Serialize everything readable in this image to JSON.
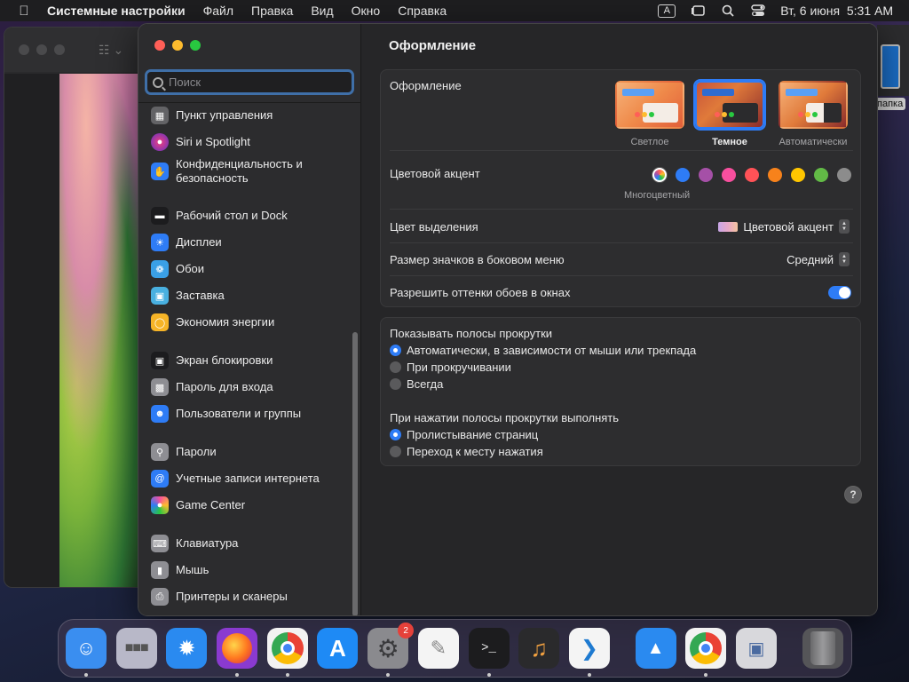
{
  "menubar": {
    "app_name": "Системные настройки",
    "items": [
      "Файл",
      "Правка",
      "Вид",
      "Окно",
      "Справка"
    ],
    "input_badge": "A",
    "datetime": "Вт, 6 июня  5:31 AM"
  },
  "background_window": {
    "edge_label": "папка"
  },
  "window": {
    "search_placeholder": "Поиск",
    "sidebar": [
      {
        "label": "Пункт управления",
        "icon": "control-center-icon",
        "color": "#636366"
      },
      {
        "label": "Siri и Spotlight",
        "icon": "siri-icon",
        "color": "#8e4ad6"
      },
      {
        "label": "Конфиденциальность и безопасность",
        "icon": "hand-icon",
        "color": "#2e7cf6"
      },
      {
        "label": "Рабочий стол и Dock",
        "icon": "dock-icon",
        "color": "#1c1c1e"
      },
      {
        "label": "Дисплеи",
        "icon": "sun-icon",
        "color": "#2e7cf6"
      },
      {
        "label": "Обои",
        "icon": "flower-icon",
        "color": "#3aa0e6"
      },
      {
        "label": "Заставка",
        "icon": "screensaver-icon",
        "color": "#49b0e0"
      },
      {
        "label": "Экономия энергии",
        "icon": "bulb-icon",
        "color": "#f6b427"
      },
      {
        "label": "Экран блокировки",
        "icon": "lock-screen-icon",
        "color": "#1c1c1e"
      },
      {
        "label": "Пароль для входа",
        "icon": "lock-icon",
        "color": "#8e8e93"
      },
      {
        "label": "Пользователи и группы",
        "icon": "users-icon",
        "color": "#2e7cf6"
      },
      {
        "label": "Пароли",
        "icon": "key-icon",
        "color": "#8e8e93"
      },
      {
        "label": "Учетные записи интернета",
        "icon": "at-icon",
        "color": "#2e7cf6"
      },
      {
        "label": "Game Center",
        "icon": "game-center-icon",
        "color": "#f2f2f2"
      },
      {
        "label": "Клавиатура",
        "icon": "keyboard-icon",
        "color": "#8e8e93"
      },
      {
        "label": "Мышь",
        "icon": "mouse-icon",
        "color": "#8e8e93"
      },
      {
        "label": "Принтеры и сканеры",
        "icon": "printer-icon",
        "color": "#8e8e93"
      }
    ],
    "content": {
      "title": "Оформление",
      "appearance_label": "Оформление",
      "themes": [
        {
          "label": "Светлое",
          "selected": false
        },
        {
          "label": "Темное",
          "selected": true
        },
        {
          "label": "Автоматически",
          "selected": false
        }
      ],
      "accent_label": "Цветовой акцент",
      "accent_caption": "Многоцветный",
      "accent_colors": [
        "multicolor",
        "#2e7cf6",
        "#a550a7",
        "#f74f9e",
        "#ff5257",
        "#f7821b",
        "#ffc600",
        "#62ba46",
        "#8c8c8c"
      ],
      "highlight_label": "Цвет выделения",
      "highlight_value": "Цветовой акцент",
      "sidebar_icon_size_label": "Размер значков в боковом меню",
      "sidebar_icon_size_value": "Средний",
      "wallpaper_tinting_label": "Разрешить оттенки обоев в окнах",
      "wallpaper_tinting_on": true,
      "scrollbars_label": "Показывать полосы прокрутки",
      "scrollbar_options": [
        {
          "label": "Автоматически, в зависимости от мыши или трекпада",
          "selected": true
        },
        {
          "label": "При прокручивании",
          "selected": false
        },
        {
          "label": "Всегда",
          "selected": false
        }
      ],
      "click_label": "При нажатии полосы прокрутки выполнять",
      "click_options": [
        {
          "label": "Пролистывание страниц",
          "selected": true
        },
        {
          "label": "Переход к месту нажатия",
          "selected": false
        }
      ],
      "help": "?"
    }
  },
  "dock": {
    "apps": [
      {
        "name": "finder-icon",
        "color": "#3a8ef0",
        "running": true
      },
      {
        "name": "launchpad-icon",
        "color": "#b8b8c8",
        "running": false
      },
      {
        "name": "safari-icon",
        "color": "#2a8af0",
        "running": false
      },
      {
        "name": "firefox-icon",
        "color": "#8a3ad0",
        "running": true
      },
      {
        "name": "chrome-icon",
        "color": "#f2f2f2",
        "running": true
      },
      {
        "name": "app-store-icon",
        "color": "#1e8af5",
        "running": false
      },
      {
        "name": "system-settings-icon",
        "color": "#8a8a8e",
        "running": true,
        "badge": "2"
      },
      {
        "name": "textedit-icon",
        "color": "#f4f4f4",
        "running": false
      },
      {
        "name": "terminal-icon",
        "color": "#1c1c1e",
        "running": true
      },
      {
        "name": "garageband-icon",
        "color": "#2a2a2c",
        "running": false
      },
      {
        "name": "vscode-icon",
        "color": "#f4f4f4",
        "running": true
      },
      {
        "name": "keynote-icon",
        "color": "#2a8af0",
        "running": false
      },
      {
        "name": "chrome-2-icon",
        "color": "#f2f2f2",
        "running": true
      },
      {
        "name": "preview-icon",
        "color": "#d8d8dc",
        "running": false
      },
      {
        "name": "trash-icon",
        "color": "#555558",
        "running": false
      }
    ]
  }
}
